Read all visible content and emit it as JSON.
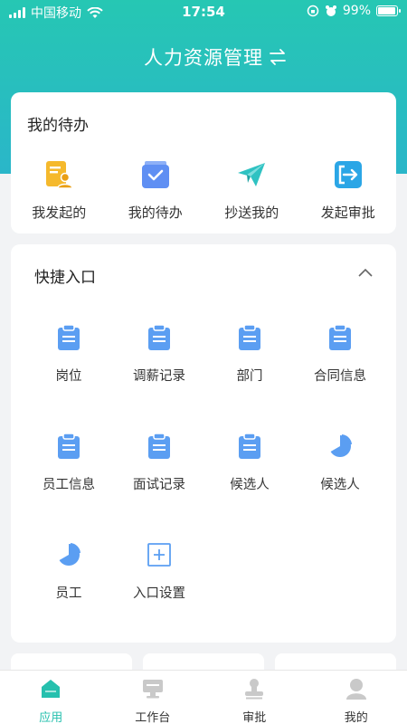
{
  "status_bar": {
    "carrier": "中国移动",
    "time": "17:54",
    "battery": "99%"
  },
  "header": {
    "title": "人力资源管理",
    "switch_icon": "swap-arrows-icon"
  },
  "todo_card": {
    "title": "我的待办",
    "items": [
      {
        "label": "我发起的",
        "icon": "document-user-icon",
        "color": "#f5b92c"
      },
      {
        "label": "我的待办",
        "icon": "inbox-tray-icon",
        "color": "#5f8ff3"
      },
      {
        "label": "抄送我的",
        "icon": "paper-plane-icon",
        "color": "#2fc2c2"
      },
      {
        "label": "发起审批",
        "icon": "exit-door-icon",
        "color": "#2ba6e6"
      }
    ]
  },
  "quick_card": {
    "title": "快捷入口",
    "collapse_icon": "chevron-up-icon",
    "rows": [
      [
        {
          "label": "岗位",
          "icon": "clipboard-icon"
        },
        {
          "label": "调薪记录",
          "icon": "clipboard-icon"
        },
        {
          "label": "部门",
          "icon": "clipboard-icon"
        },
        {
          "label": "合同信息",
          "icon": "clipboard-icon"
        }
      ],
      [
        {
          "label": "员工信息",
          "icon": "clipboard-icon"
        },
        {
          "label": "面试记录",
          "icon": "clipboard-icon"
        },
        {
          "label": "候选人",
          "icon": "clipboard-icon"
        },
        {
          "label": "候选人",
          "icon": "pie-chart-icon"
        }
      ],
      [
        {
          "label": "员工",
          "icon": "pie-chart-icon"
        },
        {
          "label": "入口设置",
          "icon": "plus-square-icon"
        }
      ]
    ],
    "icon_color": "#5b9ef2"
  },
  "tabbar": {
    "items": [
      {
        "label": "应用",
        "icon": "home-app-icon",
        "active": true
      },
      {
        "label": "工作台",
        "icon": "monitor-icon",
        "active": false
      },
      {
        "label": "审批",
        "icon": "stamp-icon",
        "active": false
      },
      {
        "label": "我的",
        "icon": "user-profile-icon",
        "active": false
      }
    ],
    "active_color": "#26c0ae",
    "inactive_color": "#c9c9c9"
  }
}
